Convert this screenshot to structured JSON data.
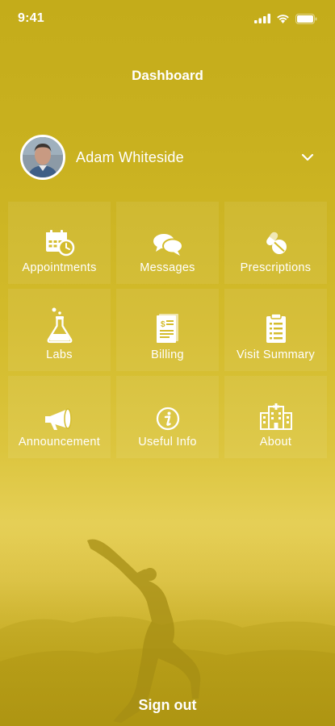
{
  "status_bar": {
    "time": "9:41"
  },
  "header": {
    "title": "Dashboard"
  },
  "profile": {
    "name": "Adam Whiteside"
  },
  "tiles": [
    {
      "label": "Appointments",
      "icon": "calendar-clock-icon"
    },
    {
      "label": "Messages",
      "icon": "chat-bubbles-icon"
    },
    {
      "label": "Prescriptions",
      "icon": "pills-icon"
    },
    {
      "label": "Labs",
      "icon": "flask-icon"
    },
    {
      "label": "Billing",
      "icon": "invoice-icon"
    },
    {
      "label": "Visit Summary",
      "icon": "clipboard-icon"
    },
    {
      "label": "Announcement",
      "icon": "megaphone-icon"
    },
    {
      "label": "Useful Info",
      "icon": "info-icon"
    },
    {
      "label": "About",
      "icon": "hospital-icon"
    }
  ],
  "footer": {
    "signout_label": "Sign out"
  },
  "colors": {
    "background": "#d3bb2b",
    "text": "#ffffff"
  }
}
